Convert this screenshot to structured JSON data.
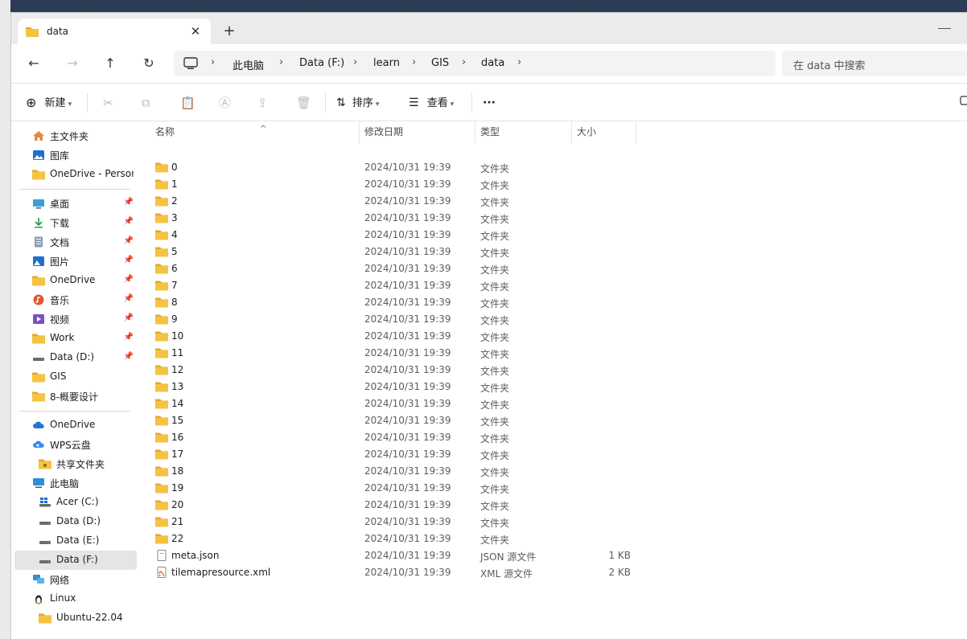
{
  "tab": {
    "title": "data",
    "close": "✕",
    "new": "+"
  },
  "nav": {
    "back": "←",
    "forward": "→",
    "up": "↑",
    "refresh": "↻"
  },
  "breadcrumb": [
    "此电脑",
    "Data (F:)",
    "learn",
    "GIS",
    "data"
  ],
  "search": {
    "placeholder": "在 data 中搜索"
  },
  "toolbar": {
    "new_label": "新建",
    "sort_label": "排序",
    "view_label": "查看",
    "more_label": "···"
  },
  "sidebar": {
    "quick": [
      {
        "label": "主文件夹",
        "icon": "home-icon"
      },
      {
        "label": "图库",
        "icon": "gallery-icon"
      },
      {
        "label": "OneDrive - Persona",
        "icon": "folder-icon"
      }
    ],
    "pinned": [
      {
        "label": "桌面",
        "icon": "desktop-icon",
        "pin": true
      },
      {
        "label": "下载",
        "icon": "download-icon",
        "pin": true
      },
      {
        "label": "文档",
        "icon": "document-icon",
        "pin": true
      },
      {
        "label": "图片",
        "icon": "picture-icon",
        "pin": true
      },
      {
        "label": "OneDrive",
        "icon": "folder-icon",
        "pin": true
      },
      {
        "label": "音乐",
        "icon": "music-icon",
        "pin": true
      },
      {
        "label": "视频",
        "icon": "video-icon",
        "pin": true
      },
      {
        "label": "Work",
        "icon": "folder-icon",
        "pin": true
      },
      {
        "label": "Data (D:)",
        "icon": "drive-icon",
        "pin": true
      },
      {
        "label": "GIS",
        "icon": "folder-icon",
        "pin": false
      },
      {
        "label": "8-概要设计",
        "icon": "folder-icon",
        "pin": false
      }
    ],
    "tree": [
      {
        "label": "OneDrive",
        "icon": "cloud-icon",
        "indent": 0
      },
      {
        "label": "WPS云盘",
        "icon": "wps-cloud-icon",
        "indent": 0
      },
      {
        "label": "共享文件夹",
        "icon": "shared-folder-icon",
        "indent": 1
      },
      {
        "label": "此电脑",
        "icon": "computer-icon",
        "indent": 0
      },
      {
        "label": "Acer (C:)",
        "icon": "windows-drive-icon",
        "indent": 1
      },
      {
        "label": "Data (D:)",
        "icon": "drive-icon",
        "indent": 1
      },
      {
        "label": "Data (E:)",
        "icon": "drive-icon",
        "indent": 1
      },
      {
        "label": "Data (F:)",
        "icon": "drive-icon",
        "indent": 1,
        "selected": true
      },
      {
        "label": "网络",
        "icon": "network-icon",
        "indent": 0
      },
      {
        "label": "Linux",
        "icon": "linux-icon",
        "indent": 0
      },
      {
        "label": "Ubuntu-22.04",
        "icon": "folder-icon",
        "indent": 1
      }
    ]
  },
  "columns": {
    "name": "名称",
    "modified": "修改日期",
    "type": "类型",
    "size": "大小"
  },
  "files": [
    {
      "name": "0",
      "date": "2024/10/31 19:39",
      "type": "文件夹",
      "size": "",
      "kind": "folder"
    },
    {
      "name": "1",
      "date": "2024/10/31 19:39",
      "type": "文件夹",
      "size": "",
      "kind": "folder"
    },
    {
      "name": "2",
      "date": "2024/10/31 19:39",
      "type": "文件夹",
      "size": "",
      "kind": "folder"
    },
    {
      "name": "3",
      "date": "2024/10/31 19:39",
      "type": "文件夹",
      "size": "",
      "kind": "folder"
    },
    {
      "name": "4",
      "date": "2024/10/31 19:39",
      "type": "文件夹",
      "size": "",
      "kind": "folder"
    },
    {
      "name": "5",
      "date": "2024/10/31 19:39",
      "type": "文件夹",
      "size": "",
      "kind": "folder"
    },
    {
      "name": "6",
      "date": "2024/10/31 19:39",
      "type": "文件夹",
      "size": "",
      "kind": "folder"
    },
    {
      "name": "7",
      "date": "2024/10/31 19:39",
      "type": "文件夹",
      "size": "",
      "kind": "folder"
    },
    {
      "name": "8",
      "date": "2024/10/31 19:39",
      "type": "文件夹",
      "size": "",
      "kind": "folder"
    },
    {
      "name": "9",
      "date": "2024/10/31 19:39",
      "type": "文件夹",
      "size": "",
      "kind": "folder"
    },
    {
      "name": "10",
      "date": "2024/10/31 19:39",
      "type": "文件夹",
      "size": "",
      "kind": "folder"
    },
    {
      "name": "11",
      "date": "2024/10/31 19:39",
      "type": "文件夹",
      "size": "",
      "kind": "folder"
    },
    {
      "name": "12",
      "date": "2024/10/31 19:39",
      "type": "文件夹",
      "size": "",
      "kind": "folder"
    },
    {
      "name": "13",
      "date": "2024/10/31 19:39",
      "type": "文件夹",
      "size": "",
      "kind": "folder"
    },
    {
      "name": "14",
      "date": "2024/10/31 19:39",
      "type": "文件夹",
      "size": "",
      "kind": "folder"
    },
    {
      "name": "15",
      "date": "2024/10/31 19:39",
      "type": "文件夹",
      "size": "",
      "kind": "folder"
    },
    {
      "name": "16",
      "date": "2024/10/31 19:39",
      "type": "文件夹",
      "size": "",
      "kind": "folder"
    },
    {
      "name": "17",
      "date": "2024/10/31 19:39",
      "type": "文件夹",
      "size": "",
      "kind": "folder"
    },
    {
      "name": "18",
      "date": "2024/10/31 19:39",
      "type": "文件夹",
      "size": "",
      "kind": "folder"
    },
    {
      "name": "19",
      "date": "2024/10/31 19:39",
      "type": "文件夹",
      "size": "",
      "kind": "folder"
    },
    {
      "name": "20",
      "date": "2024/10/31 19:39",
      "type": "文件夹",
      "size": "",
      "kind": "folder"
    },
    {
      "name": "21",
      "date": "2024/10/31 19:39",
      "type": "文件夹",
      "size": "",
      "kind": "folder"
    },
    {
      "name": "22",
      "date": "2024/10/31 19:39",
      "type": "文件夹",
      "size": "",
      "kind": "folder"
    },
    {
      "name": "meta.json",
      "date": "2024/10/31 19:39",
      "type": "JSON 源文件",
      "size": "1 KB",
      "kind": "json"
    },
    {
      "name": "tilemapresource.xml",
      "date": "2024/10/31 19:39",
      "type": "XML 源文件",
      "size": "2 KB",
      "kind": "xml"
    }
  ],
  "colors": {
    "folder": "#f5c342",
    "folder_dark": "#e5a72a",
    "accent": "#0067c0",
    "selected_bg": "#e5e5e5"
  }
}
